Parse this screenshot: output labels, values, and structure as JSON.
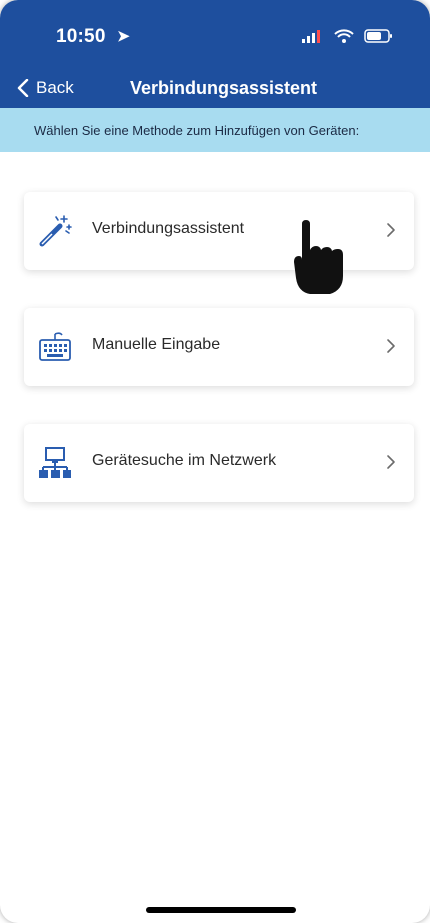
{
  "status_bar": {
    "time": "10:50",
    "location_icon": "location-arrow-icon",
    "signal_icon": "signal-icon",
    "wifi_icon": "wifi-icon",
    "battery_icon": "battery-icon"
  },
  "nav": {
    "back_label": "Back",
    "title": "Verbindungsassistent"
  },
  "subheader": {
    "text": "Wählen Sie eine Methode zum Hinzufügen von Geräten:"
  },
  "options": [
    {
      "label": "Verbindungsassistent",
      "icon": "magic-wand-icon"
    },
    {
      "label": "Manuelle Eingabe",
      "icon": "keyboard-icon"
    },
    {
      "label": "Gerätesuche im Netzwerk",
      "icon": "network-icon"
    }
  ],
  "colors": {
    "header_bg": "#1e4f9e",
    "subheader_bg": "#a8dcf0",
    "icon_blue": "#2a5db0",
    "text": "#2a2a2a"
  }
}
